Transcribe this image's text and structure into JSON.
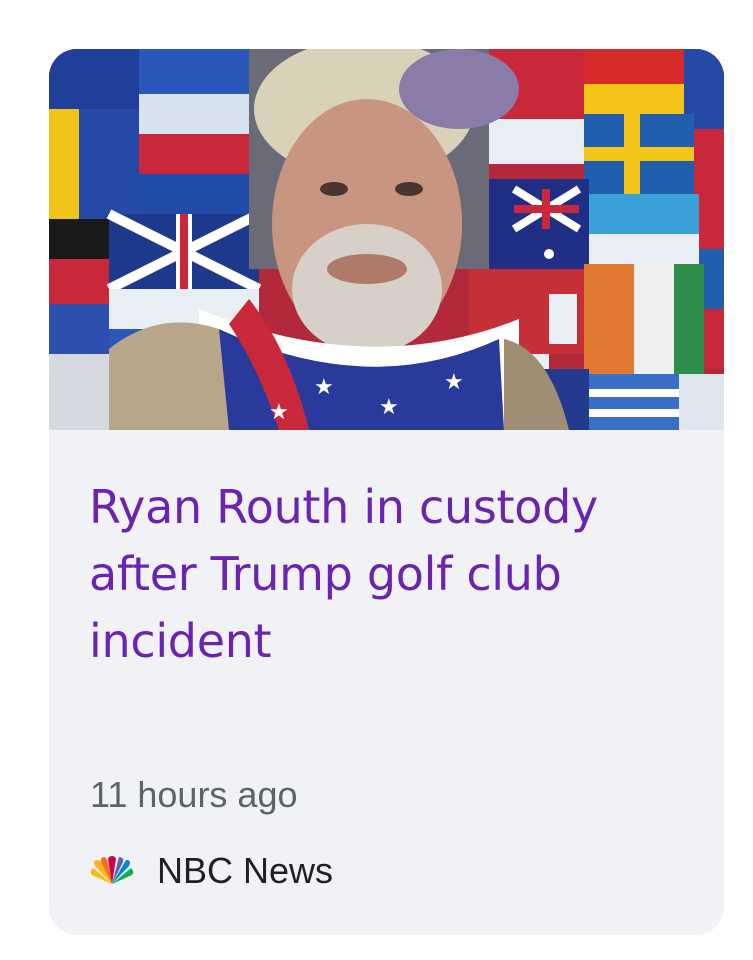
{
  "article": {
    "headline": "Ryan Routh in custody after Trump golf club incident",
    "timestamp": "11 hours ago",
    "source_name": "NBC News",
    "source_logo_icon": "nbc-peacock-icon"
  },
  "colors": {
    "headline": "#6a24b0",
    "card_background": "#f1f2f6",
    "timestamp": "#5f6368",
    "source_text": "#202124"
  }
}
